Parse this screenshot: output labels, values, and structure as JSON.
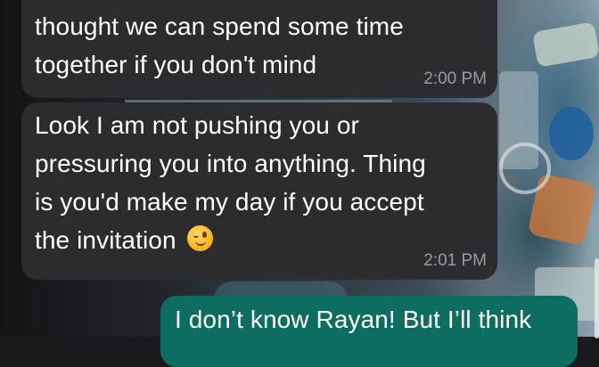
{
  "messages": [
    {
      "direction": "incoming",
      "lines": [
        "thought we can spend some time",
        "together if you don't mind"
      ],
      "time": "2:00 PM"
    },
    {
      "direction": "incoming",
      "lines": [
        "Look I am not pushing you or",
        "pressuring you into anything. Thing",
        "is you'd make my day if you accept",
        "the invitation"
      ],
      "emoji": "winking-face",
      "time": "2:01 PM"
    },
    {
      "direction": "outgoing",
      "lines": [
        "I don’t know Rayan! But I’ll think"
      ]
    }
  ],
  "colors": {
    "incoming_bubble": "#2c2c2e",
    "outgoing_bubble": "#0c6d60",
    "text": "#ffffff",
    "timestamp": "#9a9aa0"
  }
}
